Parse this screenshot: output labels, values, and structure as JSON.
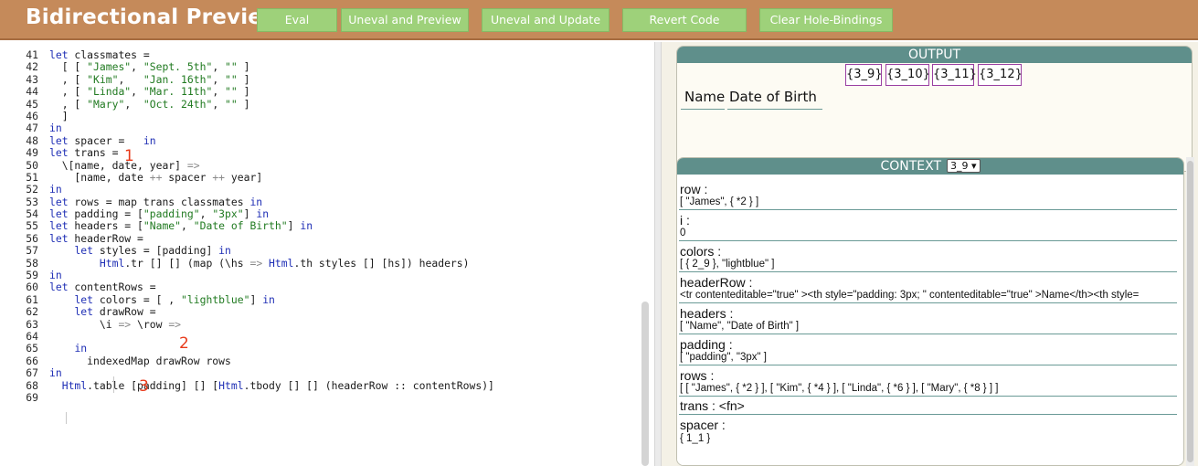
{
  "app": {
    "title": "Bidirectional Preview"
  },
  "toolbar": {
    "buttons": [
      {
        "label": "Eval"
      },
      {
        "label": "Uneval and Preview"
      },
      {
        "label": "Uneval and Update"
      },
      {
        "label": "Revert Code"
      },
      {
        "label": "Clear Hole-Bindings"
      }
    ]
  },
  "editor": {
    "line_numbers": [
      "41",
      "42",
      "43",
      "44",
      "45",
      "46",
      "47",
      "48",
      "49",
      "50",
      "51",
      "52",
      "53",
      "54",
      "55",
      "56",
      "57",
      "58",
      "59",
      "60",
      "61",
      "62",
      "63",
      "64",
      "65",
      "66",
      "67",
      "68",
      "69"
    ],
    "markers": [
      "1",
      "2",
      "3"
    ]
  },
  "output": {
    "header": "OUTPUT",
    "holes": [
      "{3_9}",
      "{3_10}",
      "{3_11}",
      "{3_12}"
    ],
    "table_headers": [
      "Name",
      "Date of Birth"
    ]
  },
  "context": {
    "header": "CONTEXT",
    "selected": "3_9",
    "items": [
      {
        "label": "row :",
        "value": "[ \"James\", { *2 } ]"
      },
      {
        "label": "i :",
        "value": "0"
      },
      {
        "label": "colors :",
        "value": "[ { 2_9 }, \"lightblue\" ]"
      },
      {
        "label": "headerRow :",
        "value": "<tr contenteditable=\"true\" ><th style=\"padding: 3px; \" contenteditable=\"true\" >Name</th><th style="
      },
      {
        "label": "headers :",
        "value": "[ \"Name\", \"Date of Birth\" ]"
      },
      {
        "label": "padding :",
        "value": "[ \"padding\", \"3px\" ]"
      },
      {
        "label": "rows :",
        "value": "[ [ \"James\", { *2 } ], [ \"Kim\", { *4 } ], [ \"Linda\", { *6 } ], [ \"Mary\", { *8 } ] ]"
      },
      {
        "label": "trans : <fn>",
        "value": ""
      },
      {
        "label": "spacer :",
        "value": "{ 1_1 }"
      }
    ]
  },
  "colors": {
    "toolbar": "#c58a5a",
    "button": "#9ed17a",
    "panel_header": "#5f8f8b",
    "hole_border": "#9a3fa2",
    "keyword": "#1f2fb5",
    "string": "#207a20",
    "marker": "#e83a1a"
  }
}
